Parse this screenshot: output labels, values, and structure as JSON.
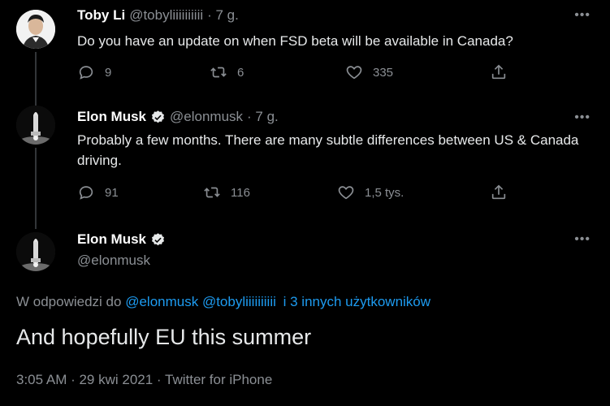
{
  "tweets": [
    {
      "name": "Toby Li",
      "handle": "@tobyliiiiiiiiii",
      "time": "· 7 g.",
      "text": "Do you have an update on when FSD beta will be available in Canada?",
      "reply_count": "9",
      "retweet_count": "6",
      "like_count": "335"
    },
    {
      "name": "Elon Musk",
      "handle": "@elonmusk",
      "time": "· 7 g.",
      "text": "Probably a few months. There are many subtle differences between US & Canada driving.",
      "reply_count": "91",
      "retweet_count": "116",
      "like_count": "1,5 tys."
    }
  ],
  "main": {
    "name": "Elon Musk",
    "handle": "@elonmusk",
    "reply_prefix": "W odpowiedzi do",
    "reply_to_1": "@elonmusk",
    "reply_to_2": "@tobyliiiiiiiiii",
    "reply_others": "i 3 innych użytkowników",
    "text": "And hopefully EU this summer",
    "meta": "3:05 AM · 29 kwi 2021 · Twitter for iPhone"
  },
  "more_label": "•••",
  "colors": {
    "accent": "#1d9bf0",
    "background": "#000000",
    "muted": "#8b8f94"
  }
}
